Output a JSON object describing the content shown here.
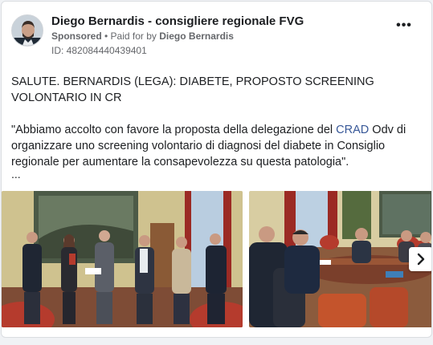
{
  "post": {
    "page_name": "Diego Bernardis - consigliere regionale FVG",
    "sponsored_label": "Sponsored",
    "separator": " • ",
    "paid_for_label": "Paid for by ",
    "paid_for_name": "Diego Bernardis",
    "ad_id": "ID: 482084440439401",
    "more_label": "•••",
    "headline": "SALUTE. BERNARDIS (LEGA): DIABETE, PROPOSTO SCREENING VOLONTARIO IN CR",
    "quote_before": "\"Abbiamo accolto con favore la proposta della delegazione del ",
    "quote_link": "CRAD",
    "quote_after": " Odv di organizzare uno screening volontario di diagnosi del diabete in Consiglio regionale per aumentare la consapevolezza su questa patologia\".",
    "truncation": "..."
  },
  "carousel": {
    "next_icon": "chevron-right-icon"
  },
  "colors": {
    "link": "#385898",
    "secondary_text": "#65676b",
    "card_border": "#dadde1"
  }
}
